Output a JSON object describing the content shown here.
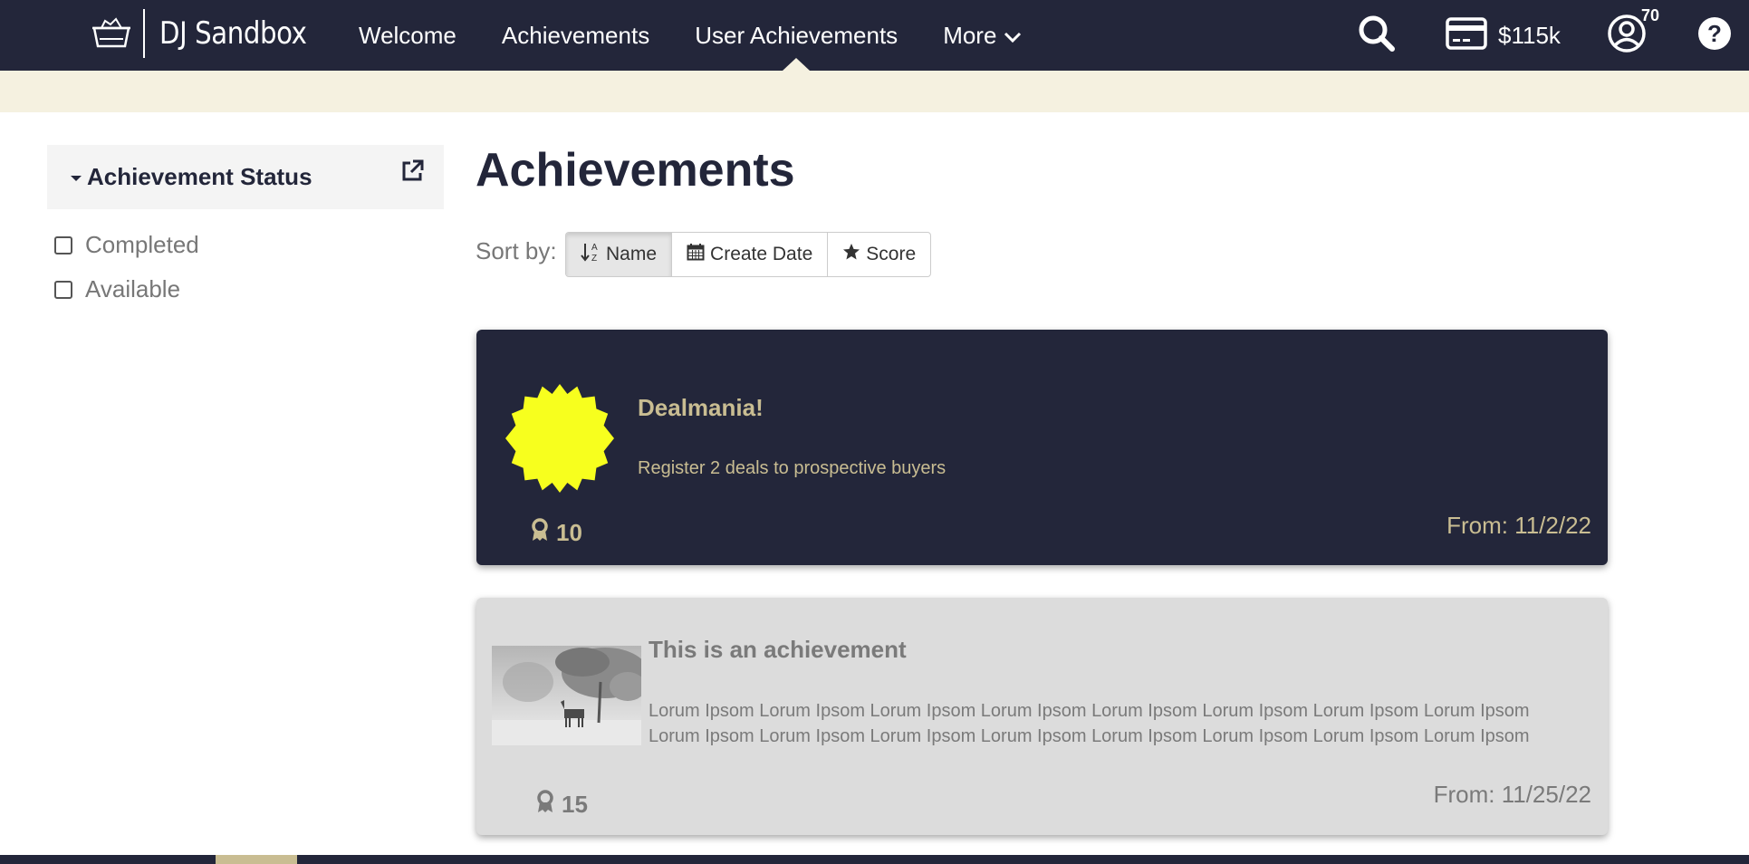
{
  "brand": {
    "name": "DJ Sandbox"
  },
  "nav": {
    "items": [
      {
        "label": "Welcome",
        "active": false
      },
      {
        "label": "Achievements",
        "active": false
      },
      {
        "label": "User Achievements",
        "active": true
      },
      {
        "label": "More",
        "active": false
      }
    ]
  },
  "tools": {
    "search_icon": "search-icon",
    "credit_amount": "$115k",
    "notification_count": "70",
    "help_icon": "help-icon"
  },
  "sidebar": {
    "filter_title": "Achievement Status",
    "options": [
      {
        "label": "Completed",
        "checked": false
      },
      {
        "label": "Available",
        "checked": false
      }
    ]
  },
  "main": {
    "title": "Achievements",
    "sort_label": "Sort by:",
    "sort_options": [
      {
        "label": "Name",
        "icon": "sort-alpha-icon",
        "active": true
      },
      {
        "label": "Create Date",
        "icon": "calendar-icon",
        "active": false
      },
      {
        "label": "Score",
        "icon": "star-icon",
        "active": false
      }
    ]
  },
  "achievements": [
    {
      "title": "Dealmania!",
      "description": "Register 2 deals to prospective buyers",
      "points": "10",
      "date": "From: 11/2/22",
      "badge": "yellow-starburst",
      "theme": "dark"
    },
    {
      "title": "This is an achievement",
      "description": "Lorum Ipsom Lorum Ipsom Lorum Ipsom Lorum Ipsom Lorum Ipsom Lorum Ipsom Lorum Ipsom Lorum Ipsom Lorum Ipsom Lorum Ipsom Lorum Ipsom Lorum Ipsom Lorum Ipsom Lorum Ipsom Lorum Ipsom Lorum Ipsom",
      "points": "15",
      "date": "From: 11/25/22",
      "badge": "grayscale-photo",
      "theme": "light"
    }
  ],
  "colors": {
    "navy": "#23263a",
    "cream": "#f5f1e0",
    "gold": "#c9bd92",
    "badge_yellow": "#f7ff1e"
  }
}
